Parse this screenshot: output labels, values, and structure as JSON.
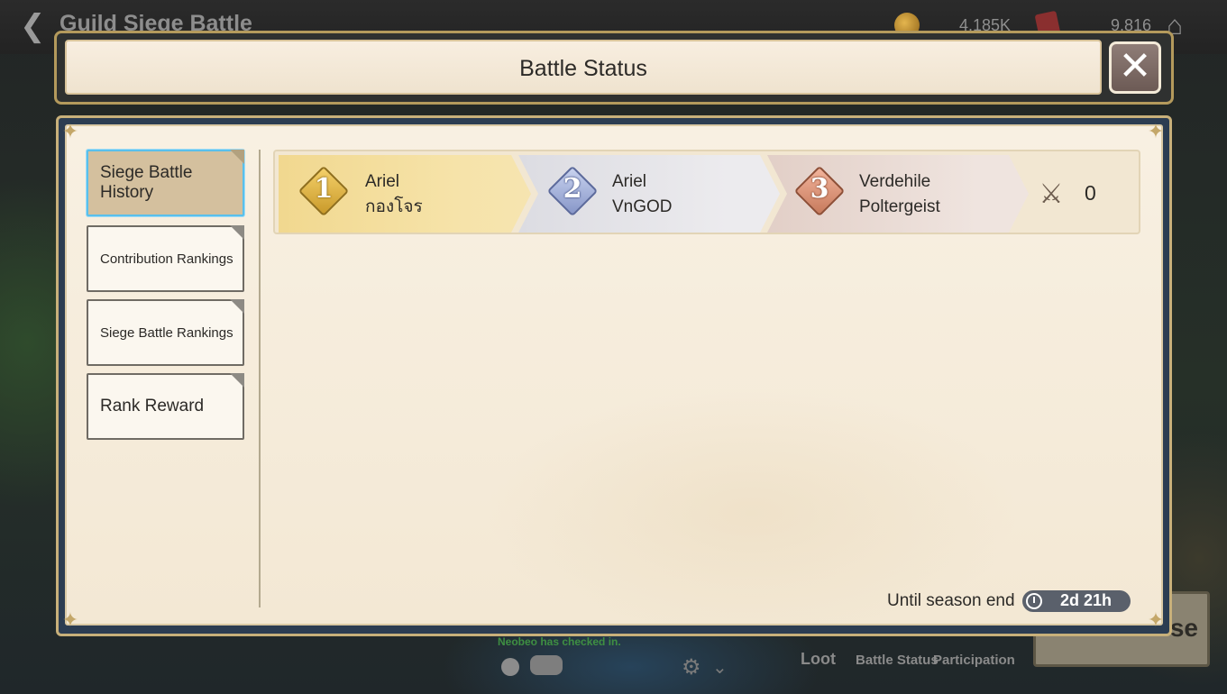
{
  "background": {
    "screen_title": "Guild Siege Battle",
    "gold": "4,185K",
    "gems": "9,816",
    "chat_notice": "Neobeo has checked in.",
    "loot_label": "Loot",
    "battle_status_label": "Battle Status",
    "participation_label": "Participation",
    "close_label": "se"
  },
  "dialog": {
    "title": "Battle Status",
    "close_icon": "close-icon"
  },
  "tabs": [
    {
      "label": "Siege Battle History",
      "active": true
    },
    {
      "label": "Contribution Rankings",
      "active": false
    },
    {
      "label": "Siege Battle Rankings",
      "active": false
    },
    {
      "label": "Rank Reward",
      "active": false
    }
  ],
  "results": {
    "ranks": [
      {
        "rank": "1",
        "guild": "Ariel",
        "sub": "กองโจร",
        "color": "#c99a2a"
      },
      {
        "rank": "2",
        "guild": "Ariel",
        "sub": "VnGOD",
        "color": "#8796c8"
      },
      {
        "rank": "3",
        "guild": "Verdehile",
        "sub": "Poltergeist",
        "color": "#c77a5c"
      }
    ],
    "score_icon": "crossed-swords-icon",
    "score": "0"
  },
  "season": {
    "label": "Until season end",
    "remaining": "2d 21h"
  }
}
